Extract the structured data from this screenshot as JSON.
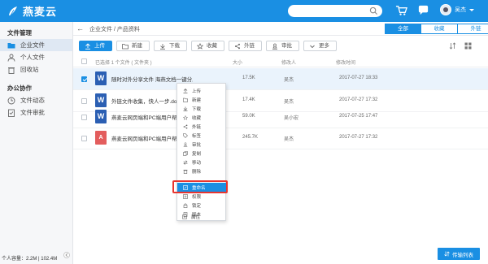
{
  "app": {
    "name": "燕麦云",
    "user": "吴杰"
  },
  "sidebar": {
    "sections": [
      {
        "title": "文件管理",
        "items": [
          {
            "label": "企业文件"
          },
          {
            "label": "个人文件"
          },
          {
            "label": "回收站"
          }
        ]
      },
      {
        "title": "办公协作",
        "items": [
          {
            "label": "文件动态"
          },
          {
            "label": "文件审批"
          }
        ]
      }
    ],
    "storage": "个人容量：2.2M | 102.4M"
  },
  "breadcrumb": "企业文件 / 产品资料",
  "tabs": [
    {
      "label": "全部"
    },
    {
      "label": "收藏"
    },
    {
      "label": "外链"
    }
  ],
  "toolbar": {
    "upload": "上传",
    "new": "新建",
    "download": "下载",
    "favorite": "收藏",
    "share": "外链",
    "approve": "审批",
    "more": "更多"
  },
  "table": {
    "selected_summary": "已选择 1 个文件 ( 文件夹 )",
    "headers": {
      "size": "大小",
      "owner": "修改人",
      "time": "修改时间"
    },
    "rows": [
      {
        "name": "随时对外分享文件 海燕文档一键分发.docx",
        "type": "word",
        "size": "17.5K",
        "owner": "吴杰",
        "time": "2017-07-27 18:33",
        "selected": true
      },
      {
        "name": "外链文件收集，快人一步.docx",
        "type": "word",
        "size": "17.4K",
        "owner": "吴杰",
        "time": "2017-07-27 17:32",
        "selected": false
      },
      {
        "name": "燕麦云网页端和PC端用户帮助.docx",
        "type": "word",
        "size": "59.0K",
        "owner": "吴小宏",
        "time": "2017-07-25 17:47",
        "selected": false
      },
      {
        "name": "燕麦云网页端和PC端用户帮助.pdf",
        "type": "pdf",
        "size": "245.7K",
        "owner": "吴杰",
        "time": "2017-07-27 17:32",
        "selected": false
      }
    ]
  },
  "context_menu": {
    "items": [
      {
        "label": "上传",
        "icon": "upload-icon"
      },
      {
        "label": "新建",
        "icon": "folder-icon"
      },
      {
        "label": "下载",
        "icon": "download-icon"
      },
      {
        "label": "收藏",
        "icon": "star-icon"
      },
      {
        "label": "外链",
        "icon": "share-icon"
      },
      {
        "label": "标签",
        "icon": "tag-icon"
      },
      {
        "label": "审批",
        "icon": "approve-icon"
      },
      {
        "label": "复制",
        "icon": "copy-icon"
      },
      {
        "label": "移动",
        "icon": "move-icon"
      },
      {
        "label": "删除",
        "icon": "trash-icon"
      },
      {
        "label": "重命名",
        "icon": "rename-icon"
      },
      {
        "label": "权限",
        "icon": "permission-icon"
      },
      {
        "label": "锁定",
        "icon": "lock-icon"
      },
      {
        "label": "版本",
        "icon": "version-icon"
      },
      {
        "label": "属性",
        "icon": "info-icon"
      }
    ],
    "highlighted_index": 10
  },
  "transfer_button": "传输列表",
  "colors": {
    "brand": "#1a8fe3",
    "highlight_frame": "#e8352f"
  }
}
